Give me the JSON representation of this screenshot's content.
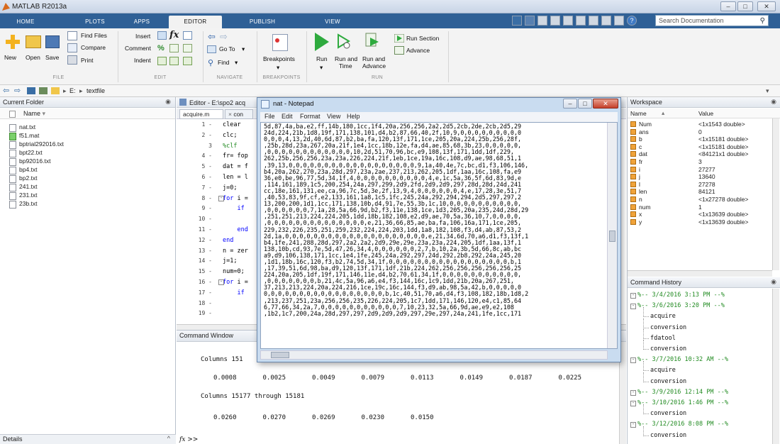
{
  "window": {
    "title": "MATLAB R2013a"
  },
  "tabs": [
    "HOME",
    "PLOTS",
    "APPS",
    "EDITOR",
    "PUBLISH",
    "VIEW"
  ],
  "search": {
    "placeholder": "Search Documentation"
  },
  "ribbon": {
    "file": {
      "new": "New",
      "open": "Open",
      "save": "Save",
      "find_files": "Find Files",
      "compare": "Compare",
      "print": "Print",
      "group": "FILE"
    },
    "edit": {
      "insert": "Insert",
      "comment": "Comment",
      "indent": "Indent",
      "group": "EDIT"
    },
    "navigate": {
      "go_to": "Go To",
      "find": "Find",
      "group": "NAVIGATE"
    },
    "breakpoints": {
      "label": "Breakpoints",
      "group": "BREAKPOINTS"
    },
    "run": {
      "run": "Run",
      "run_and_time_1": "Run and",
      "run_and_time_2": "Time",
      "run_and_advance_1": "Run and",
      "run_and_advance_2": "Advance",
      "run_section": "Run Section",
      "advance": "Advance",
      "group": "RUN"
    }
  },
  "path": {
    "drive": "E:",
    "folder": "textfile"
  },
  "current_folder": {
    "title": "Current Folder",
    "column": "Name",
    "files": [
      "nat.txt",
      "f51.mat",
      "bptrial292016.txt",
      "bpt22.txt",
      "bp92016.txt",
      "bp4.txt",
      "bp2.txt",
      "241.txt",
      "231.txt",
      "23b.txt"
    ]
  },
  "details": {
    "label": "Details"
  },
  "editor": {
    "title": "Editor - E:\\spo2 acq",
    "tabs": [
      "acquire.m",
      "con"
    ],
    "lines": [
      {
        "n": "1 -",
        "t": "clear"
      },
      {
        "n": "2 -",
        "t": "clc;"
      },
      {
        "n": "3",
        "t": "%clf"
      },
      {
        "n": "4 -",
        "t": "fr= fop"
      },
      {
        "n": "5 -",
        "t": "dat = f"
      },
      {
        "n": "6 -",
        "t": "len = l"
      },
      {
        "n": "7 -",
        "t": "j=0;"
      },
      {
        "n": "8 -",
        "t": "for i ="
      },
      {
        "n": "9 -",
        "t": "    if"
      },
      {
        "n": "10 -",
        "t": ""
      },
      {
        "n": "11 -",
        "t": "    end"
      },
      {
        "n": "12 -",
        "t": "end"
      },
      {
        "n": "13 -",
        "t": "n = zer"
      },
      {
        "n": "14 -",
        "t": "j=1;"
      },
      {
        "n": "15 -",
        "t": "num=0;"
      },
      {
        "n": "16 -",
        "t": "for i ="
      },
      {
        "n": "17 -",
        "t": "    if"
      },
      {
        "n": "18 -",
        "t": ""
      },
      {
        "n": "19 -",
        "t": ""
      }
    ]
  },
  "command_window": {
    "title": "Command Window",
    "columns_line_1": "Columns 151",
    "values_1": [
      "0.0008",
      "0.0025",
      "0.0049",
      "0.0079",
      "0.0113",
      "0.0149",
      "0.0187",
      "0.0225"
    ],
    "columns_line_2": "Columns 15177 through 15181",
    "values_2": [
      "0.0260",
      "0.0270",
      "0.0269",
      "0.0230",
      "0.0150"
    ],
    "prompt": "fx >>"
  },
  "workspace": {
    "title": "Workspace",
    "col_name": "Name",
    "col_value": "Value",
    "vars": [
      {
        "name": "Num",
        "value": "<1x1543 double>"
      },
      {
        "name": "ans",
        "value": "0"
      },
      {
        "name": "b",
        "value": "<1x15181 double>"
      },
      {
        "name": "c",
        "value": "<1x15181 double>"
      },
      {
        "name": "dat",
        "value": "<84121x1 double>"
      },
      {
        "name": "fr",
        "value": "3"
      },
      {
        "name": "i",
        "value": "27277"
      },
      {
        "name": "j",
        "value": "13640"
      },
      {
        "name": "l",
        "value": "27278"
      },
      {
        "name": "len",
        "value": "84121"
      },
      {
        "name": "n",
        "value": "<1x27278 double>"
      },
      {
        "name": "num",
        "value": "1"
      },
      {
        "name": "x",
        "value": "<1x13639 double>"
      },
      {
        "name": "y",
        "value": "<1x13639 double>"
      }
    ]
  },
  "history": {
    "title": "Command History",
    "entries": [
      {
        "text": "%-- 3/4/2016 3:13 PM --%",
        "ts": true
      },
      {
        "text": "%-- 3/6/2016 3:20 PM --%",
        "ts": true
      },
      {
        "text": "acquire",
        "ts": false
      },
      {
        "text": "conversion",
        "ts": false
      },
      {
        "text": "fdatool",
        "ts": false
      },
      {
        "text": "conversion",
        "ts": false
      },
      {
        "text": "%-- 3/7/2016 10:32 AM --%",
        "ts": true
      },
      {
        "text": "acquire",
        "ts": false
      },
      {
        "text": "conversion",
        "ts": false
      },
      {
        "text": "%-- 3/9/2016 12:14 PM --%",
        "ts": true
      },
      {
        "text": "%-- 3/10/2016 1:46 PM --%",
        "ts": true
      },
      {
        "text": "conversion",
        "ts": false
      },
      {
        "text": "%-- 3/12/2016 8:08 PM --%",
        "ts": true
      },
      {
        "text": "conversion",
        "ts": false
      }
    ]
  },
  "notepad": {
    "title": "nat - Notepad",
    "menu": [
      "File",
      "Edit",
      "Format",
      "View",
      "Help"
    ],
    "lines": [
      "5d,87,4a,ba,e2,ff,14b,180,1cc,1f4,20a,256,256,2a2,2d5,2cb,2de,2cb,2d5,29",
      "24d,224,21b,1d8,19f,171,138,101,d4,b2,87,66,40,2f,10,9,0,0,0,0,0,0,0,0,0",
      "0,0,0,4,13,2d,40,6d,87,b2,ba,fa,120,13f,171,1ce,205,20a,224,25b,256,28f,",
      ",25b,28d,23a,267,20a,21f,1e4,1cc,18b,12e,fa,d4,ae,85,68,3b,23,0,0,0,0,0,",
      ",0,0,0,0,0,0,0,0,0,0,0,0,10,2d,51,70,96,bc,e9,108,13f,171,1dd,1df,229,",
      "262,25b,256,256,23a,23a,226,224,21f,1eb,1ce,19a,16c,108,d9,ae,98,68,51,1",
      ",39,13,0,0,0,0,0,0,0,0,0,0,0,0,0,0,0,0,0,0,9,1a,40,4e,7c,bc,d1,f3,106,146,",
      "b4,20a,262,270,23a,28d,297,23a,2ae,237,213,262,205,1df,1aa,16c,108,fa,e9",
      "36,e0,be,96,77,5d,34,1f,4,0,0,0,0,0,0,0,0,0,0,4,e,1c,5a,36,5f,6d,83,9d,e",
      ",114,161,189,1c5,200,254,24a,297,299,2d9,2fd,2d9,2d9,297,28d,28d,24d,241",
      "cc,18e,161,131,ee,ca,96,7c,5d,3e,2f,13,9,4,0,0,0,0,0,0,4,e,17,28,3e,51,7",
      ",40,53,83,9f,cf,e2,133,161,1a8,1c5,1fc,245,24a,292,294,294,2d5,297,297,2",
      "13,200,200,1d1,1cc,171,138,10b,d4,91,7e,55,3b,1c,10,0,0,0,0,0,0,0,0,0,0,",
      ",0,0,0,0,0,0,7,1a,28,5a,66,9d,b2,f3,11e,138,1ce,1d3,205,20a,235,24d,28d,29",
      ",251,251,213,224,224,205,1dd,18b,182,108,e2,d9,ae,70,5a,36,10,7,0,0,0,0,",
      ",0,0,0,0,0,0,0,0,0,0,0,0,0,0,e,21,36,66,85,ae,ba,fa,106,16a,171,1ce,205,",
      "229,232,226,235,251,259,232,224,224,203,1dd,1a8,182,108,f3,d4,ab,87,53,2",
      "2d,1a,0,0,0,0,0,0,0,0,0,0,0,0,0,0,0,0,0,0,0,0,e,21,34,6d,70,a6,d1,f3,13f,1",
      "b4,1fe,241,288,28d,297,2a2,2a2,2d9,29e,29e,23a,23a,224,205,1df,1aa,13f,1",
      "138,10b,cd,93,7e,5d,47,26,34,4,0,0,0,0,0,0,2,7,b,10,2a,3b,5d,66,8c,ab,bc",
      "a9,d9,106,138,171,1cc,1e4,1fe,245,24a,292,297,24d,292,2b8,292,24a,245,20",
      ",1d1,18b,16c,120,f3,b2,74,5d,34,1f,0,0,0,0,0,0,0,0,0,0,0,0,0,0,0,0,0,b,1",
      ",17,39,51,6d,98,ba,d9,120,13f,171,1df,21b,224,262,256,256,256,256,256,25",
      "224,20a,205,1df,19f,171,146,11e,d4,b2,70,61,34,1f,0,0,0,0,0,0,0,0,0,0,0,",
      ",0,0,0,0,0,0,0,b,21,4c,5a,96,a6,e4,f3,144,16c,1c9,1dd,21b,20a,267,251,",
      "37,213,213,224,20a,224,216,1ce,19c,16c,144,f3,d9,ab,98,5a,42,b,0,0,0,0,0",
      "0,0,0,0,0,0,0,0,0,0,0,0,0,0,0,0,0,b,1c,40,51,70,a6,d4,f3,108,182,18b,1d8,2",
      ",213,237,251,23a,256,256,235,226,224,205,1c7,1dd,171,146,120,e4,c1,85,64",
      "6,77,66,34,2a,7,0,0,0,0,0,0,0,0,0,0,0,7,10,23,32,5a,66,9d,ae,e9,e2,108",
      ",1b2,1c7,200,24a,28d,297,297,2d9,2d9,2d9,297,29e,297,24a,241,1fe,1cc,171"
    ]
  }
}
